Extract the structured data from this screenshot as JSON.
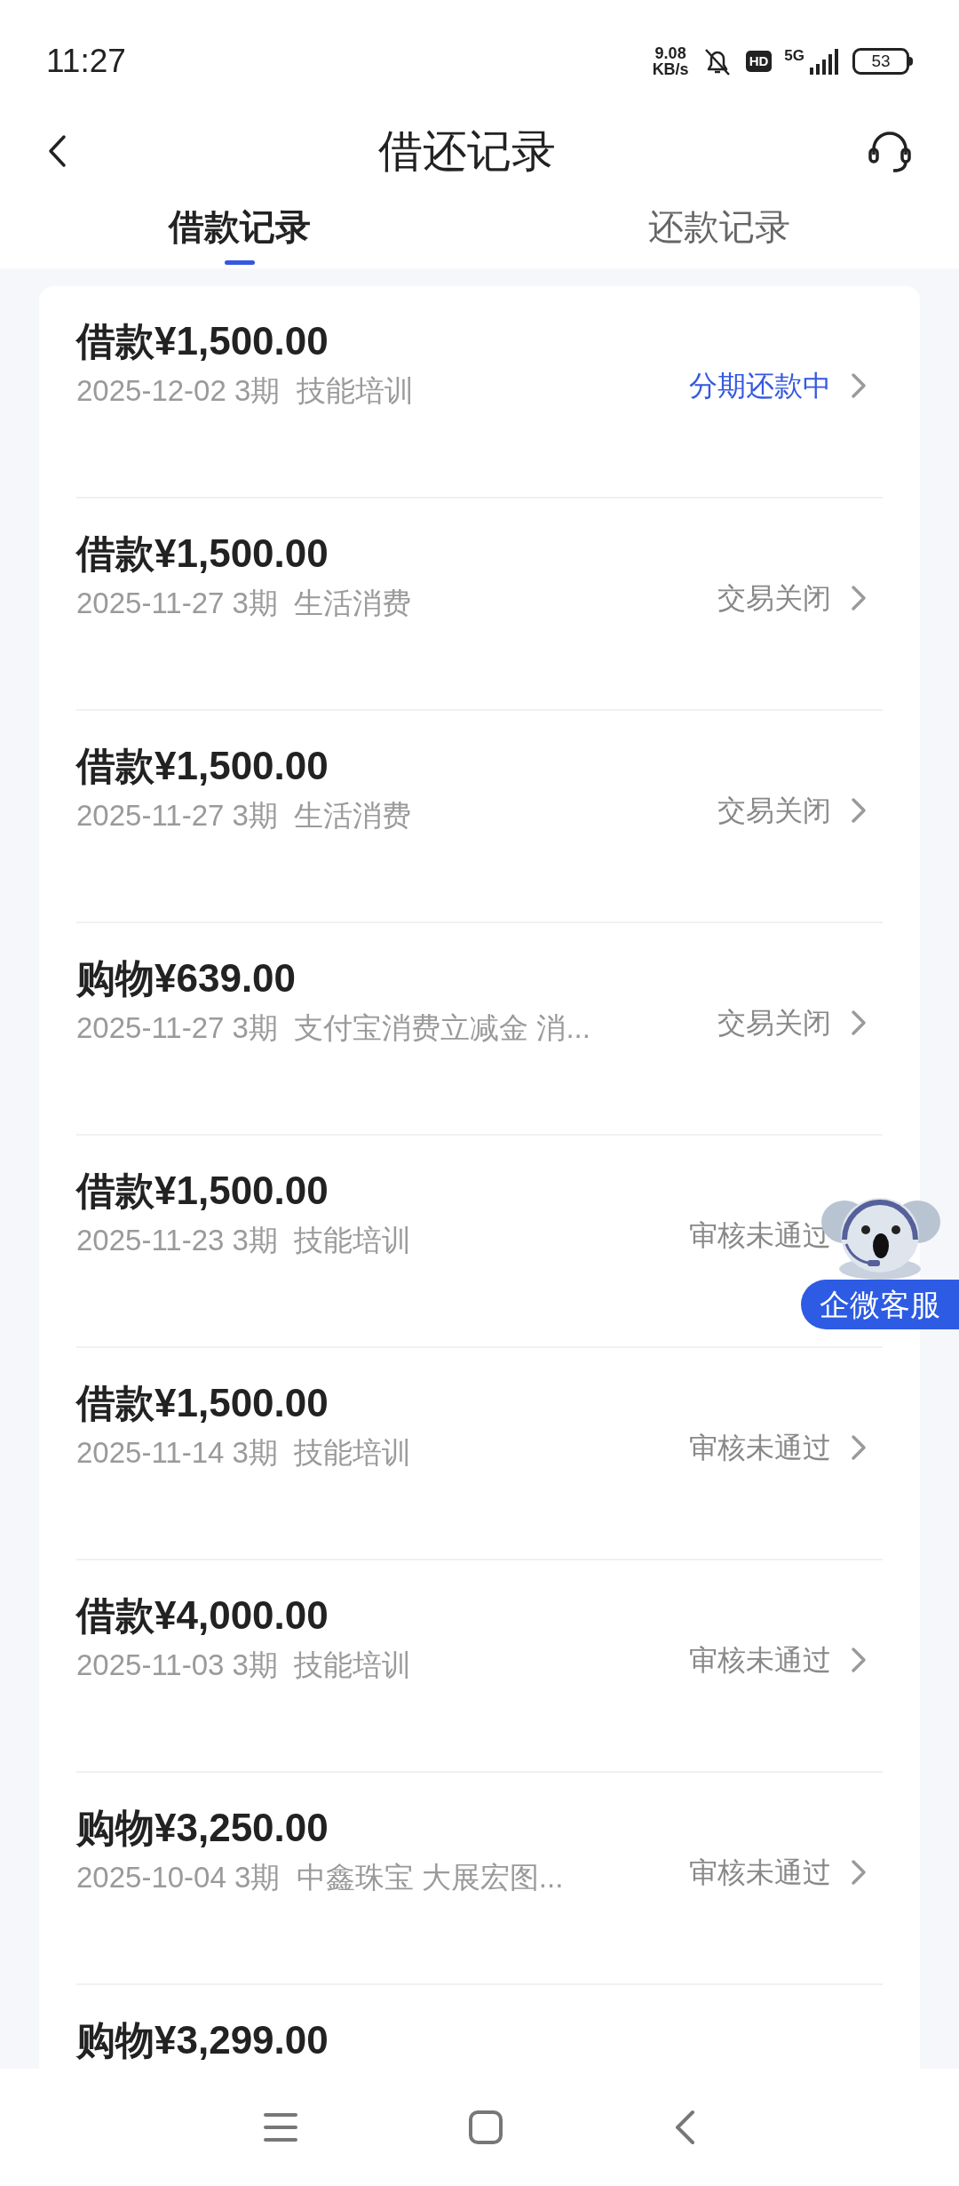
{
  "status_bar": {
    "time": "11:27",
    "net_speed_value": "9.08",
    "net_speed_unit": "KB/s",
    "hd": "HD",
    "network": "5G",
    "battery": "53"
  },
  "header": {
    "title": "借还记录"
  },
  "tabs": [
    {
      "label": "借款记录",
      "selected": true
    },
    {
      "label": "还款记录",
      "selected": false
    }
  ],
  "records": [
    {
      "title": "借款¥1,500.00",
      "detail": "2025-12-02 3期  技能培训",
      "status": "分期还款中",
      "highlighted": true
    },
    {
      "title": "借款¥1,500.00",
      "detail": "2025-11-27 3期  生活消费",
      "status": "交易关闭",
      "highlighted": false
    },
    {
      "title": "借款¥1,500.00",
      "detail": "2025-11-27 3期  生活消费",
      "status": "交易关闭",
      "highlighted": false
    },
    {
      "title": "购物¥639.00",
      "detail": "2025-11-27 3期  支付宝消费立减金 消...",
      "status": "交易关闭",
      "highlighted": false
    },
    {
      "title": "借款¥1,500.00",
      "detail": "2025-11-23 3期  技能培训",
      "status": "审核未通过",
      "highlighted": false,
      "chevron": false
    },
    {
      "title": "借款¥1,500.00",
      "detail": "2025-11-14 3期  技能培训",
      "status": "审核未通过",
      "highlighted": false
    },
    {
      "title": "借款¥4,000.00",
      "detail": "2025-11-03 3期  技能培训",
      "status": "审核未通过",
      "highlighted": false
    },
    {
      "title": "购物¥3,250.00",
      "detail": "2025-10-04 3期  中鑫珠宝 大展宏图...",
      "status": "审核未通过",
      "highlighted": false
    },
    {
      "title": "购物¥3,299.00"
    }
  ],
  "floating_service": {
    "label": "企微客服"
  }
}
